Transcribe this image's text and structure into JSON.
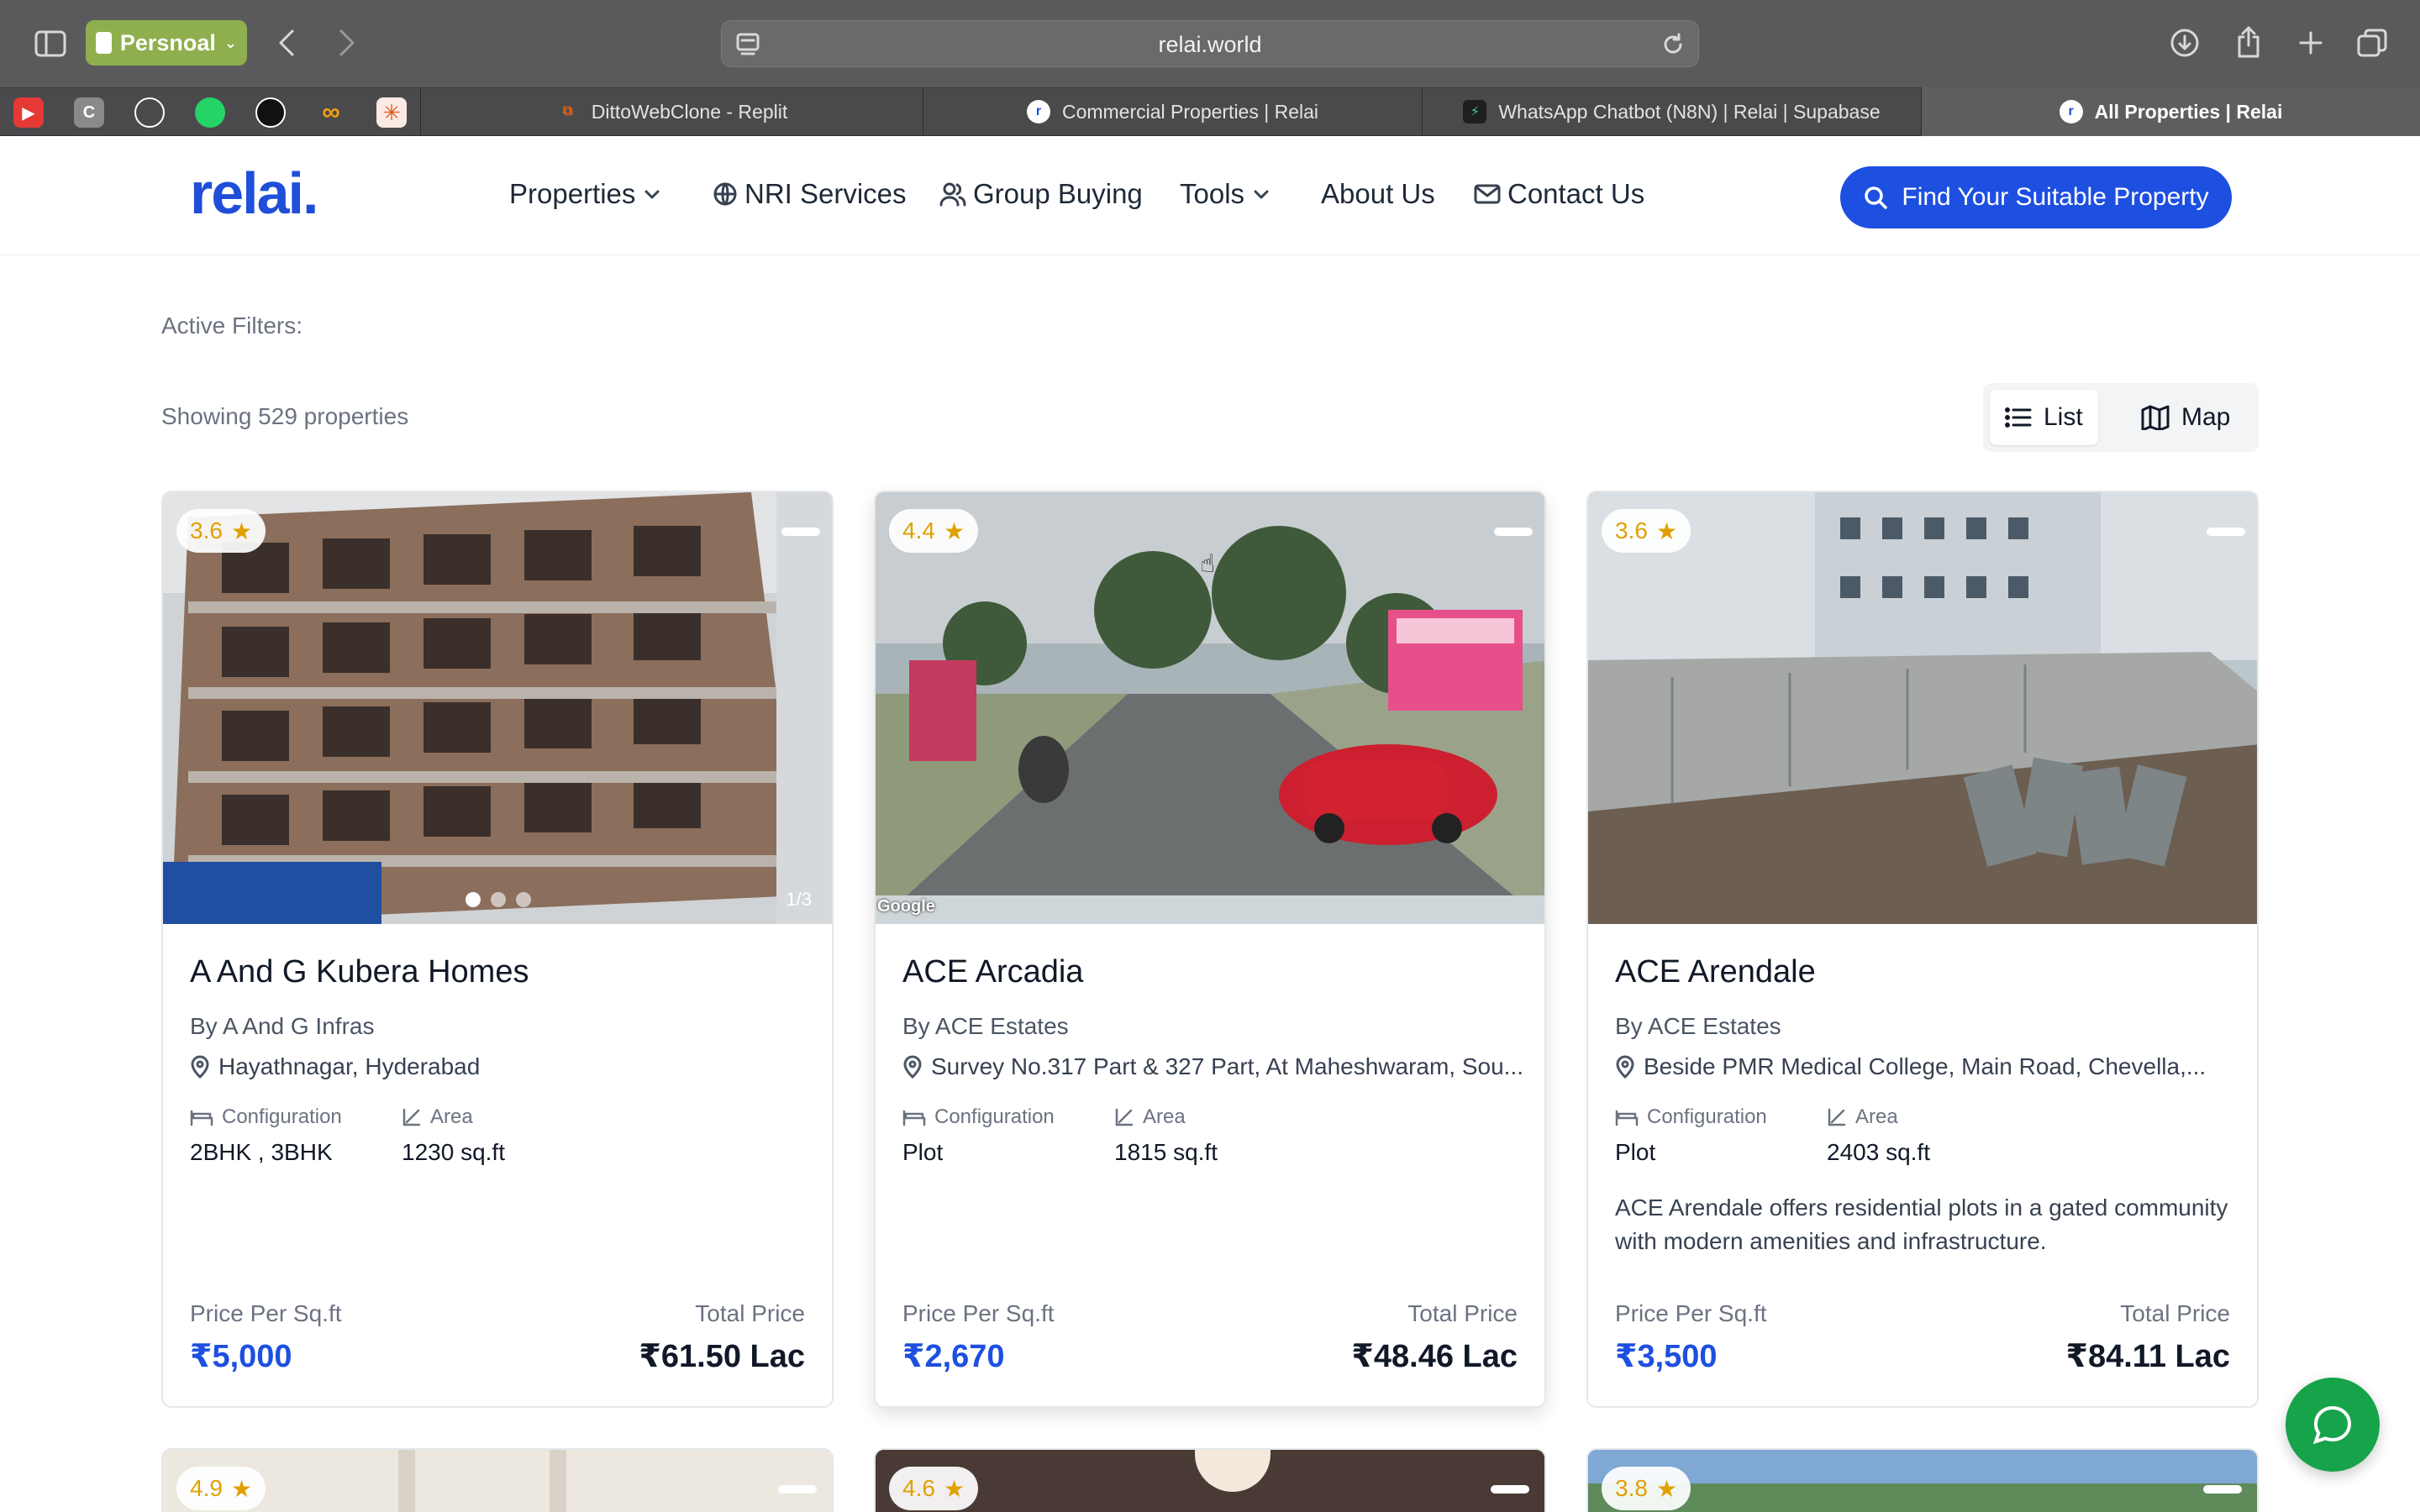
{
  "browser": {
    "profile_label": "Persnoal",
    "url": "relai.world",
    "tabs": [
      {
        "label": "DittoWebClone - Replit"
      },
      {
        "label": "Commercial Properties | Relai"
      },
      {
        "label": "WhatsApp Chatbot (N8N) | Relai | Supabase"
      },
      {
        "label": "All Properties | Relai"
      }
    ],
    "pinned": [
      "youtube-icon",
      "c-icon",
      "github-icon",
      "whatsapp-icon",
      "openai-icon",
      "infinity-icon",
      "claude-icon"
    ]
  },
  "site": {
    "logo": "relai.",
    "nav": {
      "properties": "Properties",
      "nri": "NRI Services",
      "group": "Group Buying",
      "tools": "Tools",
      "about": "About Us",
      "contact": "Contact Us"
    },
    "cta": "Find Your Suitable Property"
  },
  "filters": {
    "active_label": "Active Filters:",
    "count_text": "Showing 529 properties",
    "list_label": "List",
    "map_label": "Map"
  },
  "labels": {
    "configuration": "Configuration",
    "area": "Area",
    "price_per_sqft": "Price Per Sq.ft",
    "total_price": "Total Price"
  },
  "cards": [
    {
      "rating": "3.6",
      "title": "A And G Kubera Homes",
      "builder": "By A And G Infras",
      "location": "Hayathnagar, Hyderabad",
      "configuration": "2BHK , 3BHK",
      "area": "1230 sq.ft",
      "description": "",
      "price_per_sqft": "₹5,000",
      "total_price": "₹61.50 Lac",
      "image_counter": "1/3"
    },
    {
      "rating": "4.4",
      "title": "ACE Arcadia",
      "builder": "By ACE Estates",
      "location": "Survey No.317 Part & 327 Part, At Maheshwaram, Sou...",
      "configuration": "Plot",
      "area": "1815 sq.ft",
      "description": "",
      "price_per_sqft": "₹2,670",
      "total_price": "₹48.46 Lac",
      "image_watermark": "Google"
    },
    {
      "rating": "3.6",
      "title": "ACE Arendale",
      "builder": "By ACE Estates",
      "location": "Beside PMR Medical College, Main Road, Chevella,...",
      "configuration": "Plot",
      "area": "2403 sq.ft",
      "description": "ACE Arendale offers residential plots in a gated community with modern amenities and infrastructure.",
      "price_per_sqft": "₹3,500",
      "total_price": "₹84.11 Lac"
    }
  ],
  "next_row_ratings": [
    "4.9",
    "4.6",
    "3.8"
  ],
  "colors": {
    "brand": "#1d4fe0",
    "rating": "#e0a100",
    "chat": "#16a34a"
  }
}
